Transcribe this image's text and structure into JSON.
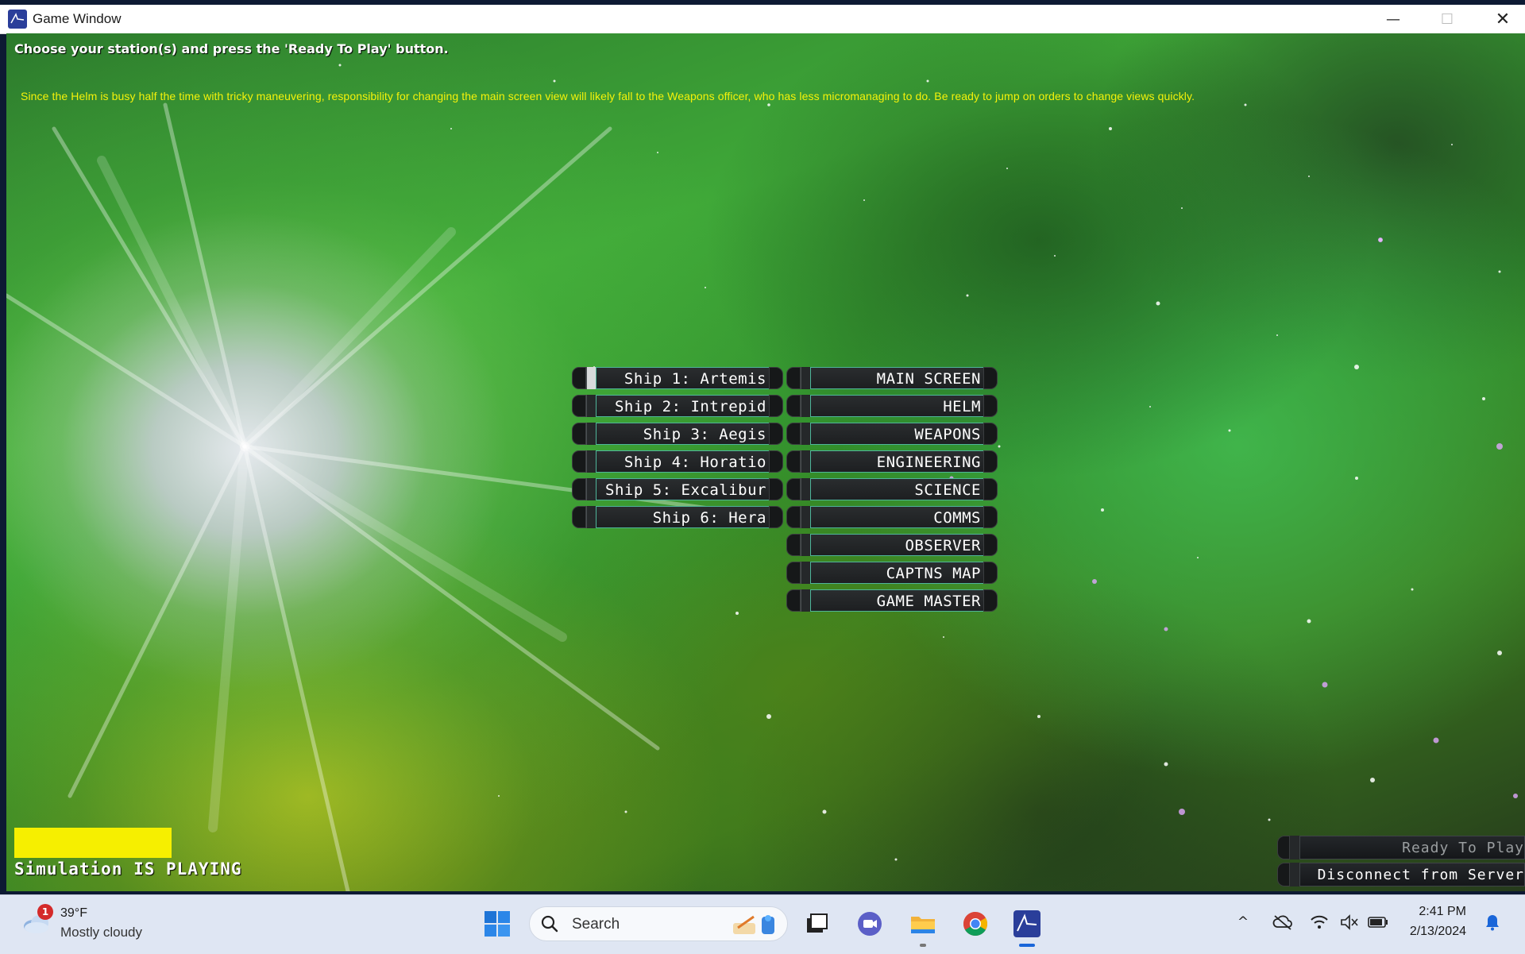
{
  "window": {
    "title": "Game Window",
    "controls": {
      "minimize": "—",
      "maximize": "☐",
      "close": "✕"
    }
  },
  "game": {
    "instruction": "Choose your station(s) and press the 'Ready To Play' button.",
    "tip": "Since the Helm is busy half the time with tricky maneuvering, responsibility for changing the main screen view will likely fall to the Weapons officer, who has less micromanaging to do. Be ready to jump on orders to change views quickly.",
    "ships": [
      {
        "label": "Ship 1: Artemis",
        "selected": true
      },
      {
        "label": "Ship 2: Intrepid",
        "selected": false
      },
      {
        "label": "Ship 3: Aegis",
        "selected": false
      },
      {
        "label": "Ship 4: Horatio",
        "selected": false
      },
      {
        "label": "Ship 5: Excalibur",
        "selected": false
      },
      {
        "label": "Ship 6: Hera",
        "selected": false
      }
    ],
    "stations": [
      {
        "label": "MAIN SCREEN"
      },
      {
        "label": "HELM"
      },
      {
        "label": "WEAPONS"
      },
      {
        "label": "ENGINEERING"
      },
      {
        "label": "SCIENCE"
      },
      {
        "label": "COMMS"
      },
      {
        "label": "OBSERVER"
      },
      {
        "label": "CAPTNS MAP"
      },
      {
        "label": "GAME MASTER"
      }
    ],
    "status_color": "#f6ef00",
    "simulation_status": "Simulation IS PLAYING",
    "ready_button": "Ready To Play",
    "disconnect_button": "Disconnect from Server"
  },
  "taskbar": {
    "weather": {
      "badge": "1",
      "temp": "39°F",
      "desc": "Mostly cloudy",
      "icon": "cloudy-weather-icon"
    },
    "search_placeholder": "Search",
    "apps": [
      "start-icon",
      "file-explorer-icon",
      "chrome-icon",
      "video-call-icon",
      "game-app-icon"
    ],
    "tray": {
      "chevron": "^"
    },
    "clock": {
      "time": "2:41 PM",
      "date": "2/13/2024"
    }
  }
}
